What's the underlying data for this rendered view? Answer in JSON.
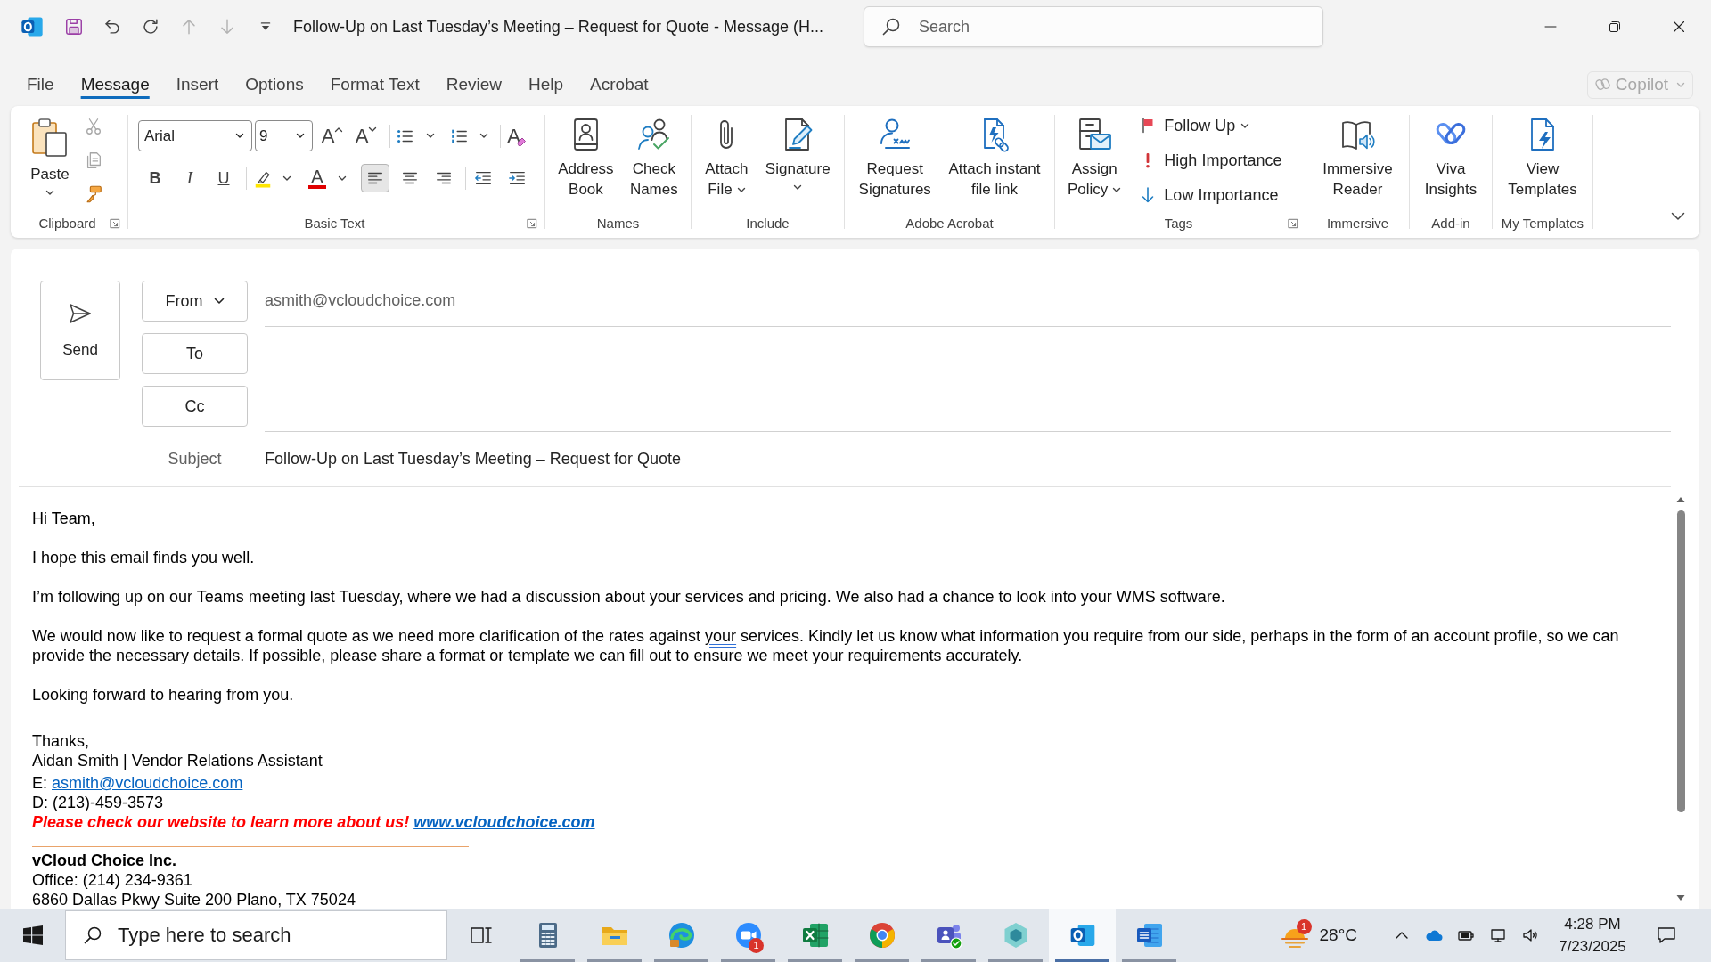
{
  "window": {
    "title": "Follow-Up on Last Tuesday’s Meeting – Request for Quote - Message (H...",
    "search": {
      "placeholder": "Search"
    }
  },
  "quick_access": [
    {
      "kind": "save",
      "disabled": false
    },
    {
      "kind": "undo",
      "disabled": false
    },
    {
      "kind": "redo",
      "disabled": false
    },
    {
      "kind": "previous",
      "disabled": true
    },
    {
      "kind": "next",
      "disabled": true
    },
    {
      "kind": "customize",
      "disabled": false
    }
  ],
  "tabs": [
    {
      "label": "File",
      "selected": false
    },
    {
      "label": "Message",
      "selected": true
    },
    {
      "label": "Insert",
      "selected": false
    },
    {
      "label": "Options",
      "selected": false
    },
    {
      "label": "Format Text",
      "selected": false
    },
    {
      "label": "Review",
      "selected": false
    },
    {
      "label": "Help",
      "selected": false
    },
    {
      "label": "Acrobat",
      "selected": false
    }
  ],
  "copilot": {
    "label": "Copilot",
    "disabled": true
  },
  "ribbon": {
    "groups": [
      {
        "kind": "clipboard",
        "label": "Clipboard",
        "launcher": true,
        "buttons": [
          {
            "kind": "paste",
            "lines": [
              "Paste"
            ],
            "dropdown": true
          }
        ],
        "tools": [
          {
            "kind": "cut",
            "disabled": true
          },
          {
            "kind": "copy",
            "disabled": true
          },
          {
            "kind": "format_painter",
            "disabled": false
          }
        ]
      },
      {
        "kind": "basic_text",
        "label": "Basic Text",
        "launcher": true,
        "font": "Arial",
        "size": "9",
        "size_buttons": [
          {
            "kind": "grow",
            "glyph": "A"
          },
          {
            "kind": "shrink",
            "glyph": "A"
          }
        ],
        "clear_glyph": "A",
        "styles": [
          {
            "kind": "bold",
            "glyph": "B"
          },
          {
            "kind": "italic",
            "glyph": "I"
          },
          {
            "kind": "underline",
            "glyph": "U"
          }
        ],
        "font_color_glyph": "A",
        "alignment": [
          {
            "kind": "left",
            "selected": true
          },
          {
            "kind": "center",
            "selected": false
          },
          {
            "kind": "right",
            "selected": false
          }
        ]
      },
      {
        "kind": "buttons",
        "label": "Names",
        "launcher": false,
        "buttons": [
          {
            "kind": "address_book",
            "lines": [
              "Address",
              "Book"
            ],
            "dropdown": false
          },
          {
            "kind": "check_names",
            "lines": [
              "Check",
              "Names"
            ],
            "dropdown": false
          }
        ]
      },
      {
        "kind": "buttons",
        "label": "Include",
        "launcher": false,
        "buttons": [
          {
            "kind": "attach_file",
            "lines": [
              "Attach",
              "File"
            ],
            "dropdown": true
          },
          {
            "kind": "signature",
            "lines": [
              "Signature"
            ],
            "dropdown": true
          }
        ]
      },
      {
        "kind": "buttons",
        "label": "Adobe Acrobat",
        "launcher": false,
        "buttons": [
          {
            "kind": "request_signatures",
            "lines": [
              "Request",
              "Signatures"
            ],
            "dropdown": false
          },
          {
            "kind": "instant_link",
            "lines": [
              "Attach instant",
              "file link"
            ],
            "dropdown": false
          }
        ]
      },
      {
        "kind": "tags",
        "label": "Tags",
        "launcher": true,
        "buttons": [
          {
            "kind": "assign_policy",
            "lines": [
              "Assign",
              "Policy"
            ],
            "dropdown": true
          }
        ],
        "small_buttons": [
          {
            "kind": "follow_up",
            "label": "Follow Up",
            "dropdown": true
          },
          {
            "kind": "high_importance",
            "label": "High Importance",
            "dropdown": false
          },
          {
            "kind": "low_importance",
            "label": "Low Importance",
            "dropdown": false
          }
        ]
      },
      {
        "kind": "buttons",
        "label": "Immersive",
        "launcher": false,
        "buttons": [
          {
            "kind": "immersive_reader",
            "lines": [
              "Immersive",
              "Reader"
            ],
            "dropdown": false
          }
        ]
      },
      {
        "kind": "buttons",
        "label": "Add-in",
        "launcher": false,
        "buttons": [
          {
            "kind": "viva_insights",
            "lines": [
              "Viva",
              "Insights"
            ],
            "dropdown": false
          }
        ]
      },
      {
        "kind": "buttons",
        "label": "My Templates",
        "launcher": false,
        "buttons": [
          {
            "kind": "view_templates",
            "lines": [
              "View",
              "Templates"
            ],
            "dropdown": false
          }
        ]
      }
    ]
  },
  "compose": {
    "send": {
      "label": "Send"
    },
    "from": {
      "label": "From",
      "dropdown": true,
      "value": "asmith@vcloudchoice.com"
    },
    "to": {
      "label": "To"
    },
    "cc": {
      "label": "Cc"
    },
    "subject": {
      "label": "Subject",
      "value": "Follow-Up on Last Tuesday’s Meeting – Request for Quote"
    }
  },
  "body": {
    "paragraphs": [
      {
        "segments": [
          {
            "text": "Hi Team,",
            "flagged": false
          }
        ]
      },
      {
        "segments": [
          {
            "text": "I hope this email finds you well.",
            "flagged": false
          }
        ]
      },
      {
        "segments": [
          {
            "text": "I’m following up on our Teams meeting last Tuesday, where we had a discussion about your services and pricing. We also had a chance to look into your WMS software.",
            "flagged": false
          }
        ]
      },
      {
        "segments": [
          {
            "text": "We would now like to request a formal quote as we need more clarification of the rates against ",
            "flagged": false
          },
          {
            "text": "your",
            "flagged": true
          },
          {
            "text": " services. Kindly let us know what information you require from our side, perhaps in the form of an account profile, so we can provide the necessary details. If possible, please share a format or template we can fill out to ensure we meet your requirements accurately.",
            "flagged": false
          }
        ]
      },
      {
        "segments": [
          {
            "text": "Looking forward to hearing from you.",
            "flagged": false
          }
        ]
      }
    ]
  },
  "signature": {
    "closing": "Thanks,",
    "name_line": "Aidan Smith | Vendor Relations Assistant",
    "email_label": "E:",
    "email": "asmith@vcloudchoice.com",
    "phone": "D: (213)-459-3573",
    "promo": "Please check our website to learn more about us!",
    "website": "www.vcloudchoice.com",
    "company": "vCloud Choice Inc.",
    "office": "Office: (214) 234-9361",
    "address": "6860 Dallas Pkwy Suite 200 Plano, TX 75024"
  },
  "taskbar": {
    "search": {
      "placeholder": "Type here to search"
    },
    "apps": [
      {
        "kind": "task_view",
        "running": false,
        "selected": false
      },
      {
        "kind": "calculator",
        "running": true,
        "selected": false
      },
      {
        "kind": "file_explorer",
        "running": true,
        "selected": false
      },
      {
        "kind": "edge",
        "running": true,
        "selected": false
      },
      {
        "kind": "zoom",
        "running": true,
        "selected": false,
        "badge": "1"
      },
      {
        "kind": "excel",
        "running": true,
        "selected": false
      },
      {
        "kind": "chrome",
        "running": true,
        "selected": false
      },
      {
        "kind": "teams",
        "running": true,
        "selected": false
      },
      {
        "kind": "hexagon_app",
        "running": true,
        "selected": false
      },
      {
        "kind": "outlook",
        "running": true,
        "selected": true
      },
      {
        "kind": "word",
        "running": true,
        "selected": false
      }
    ],
    "weather": {
      "temperature": "28°C",
      "badge": "1"
    },
    "clock": {
      "time": "4:28 PM",
      "date": "7/23/2025"
    }
  }
}
